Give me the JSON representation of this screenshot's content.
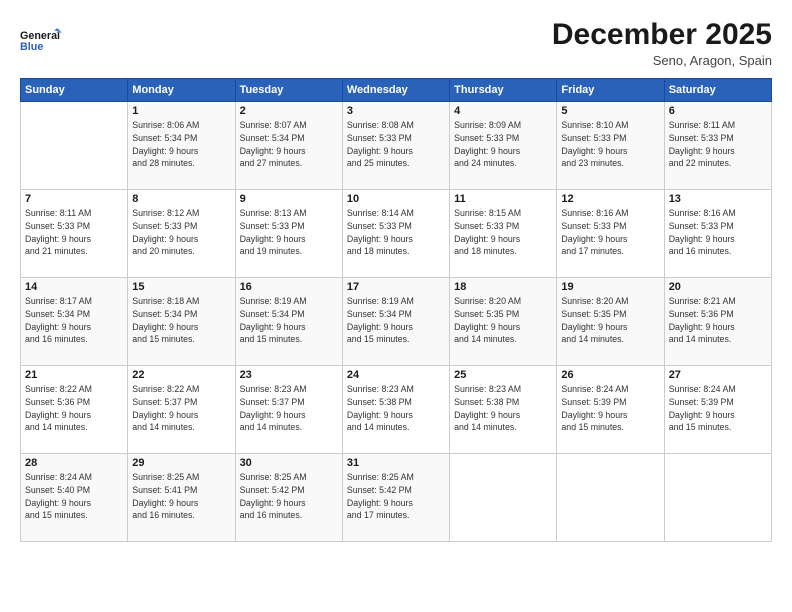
{
  "logo": {
    "line1": "General",
    "line2": "Blue"
  },
  "header": {
    "title": "December 2025",
    "subtitle": "Seno, Aragon, Spain"
  },
  "days_of_week": [
    "Sunday",
    "Monday",
    "Tuesday",
    "Wednesday",
    "Thursday",
    "Friday",
    "Saturday"
  ],
  "weeks": [
    [
      {
        "day": "",
        "detail": ""
      },
      {
        "day": "1",
        "detail": "Sunrise: 8:06 AM\nSunset: 5:34 PM\nDaylight: 9 hours\nand 28 minutes."
      },
      {
        "day": "2",
        "detail": "Sunrise: 8:07 AM\nSunset: 5:34 PM\nDaylight: 9 hours\nand 27 minutes."
      },
      {
        "day": "3",
        "detail": "Sunrise: 8:08 AM\nSunset: 5:33 PM\nDaylight: 9 hours\nand 25 minutes."
      },
      {
        "day": "4",
        "detail": "Sunrise: 8:09 AM\nSunset: 5:33 PM\nDaylight: 9 hours\nand 24 minutes."
      },
      {
        "day": "5",
        "detail": "Sunrise: 8:10 AM\nSunset: 5:33 PM\nDaylight: 9 hours\nand 23 minutes."
      },
      {
        "day": "6",
        "detail": "Sunrise: 8:11 AM\nSunset: 5:33 PM\nDaylight: 9 hours\nand 22 minutes."
      }
    ],
    [
      {
        "day": "7",
        "detail": "Sunrise: 8:11 AM\nSunset: 5:33 PM\nDaylight: 9 hours\nand 21 minutes."
      },
      {
        "day": "8",
        "detail": "Sunrise: 8:12 AM\nSunset: 5:33 PM\nDaylight: 9 hours\nand 20 minutes."
      },
      {
        "day": "9",
        "detail": "Sunrise: 8:13 AM\nSunset: 5:33 PM\nDaylight: 9 hours\nand 19 minutes."
      },
      {
        "day": "10",
        "detail": "Sunrise: 8:14 AM\nSunset: 5:33 PM\nDaylight: 9 hours\nand 18 minutes."
      },
      {
        "day": "11",
        "detail": "Sunrise: 8:15 AM\nSunset: 5:33 PM\nDaylight: 9 hours\nand 18 minutes."
      },
      {
        "day": "12",
        "detail": "Sunrise: 8:16 AM\nSunset: 5:33 PM\nDaylight: 9 hours\nand 17 minutes."
      },
      {
        "day": "13",
        "detail": "Sunrise: 8:16 AM\nSunset: 5:33 PM\nDaylight: 9 hours\nand 16 minutes."
      }
    ],
    [
      {
        "day": "14",
        "detail": "Sunrise: 8:17 AM\nSunset: 5:34 PM\nDaylight: 9 hours\nand 16 minutes."
      },
      {
        "day": "15",
        "detail": "Sunrise: 8:18 AM\nSunset: 5:34 PM\nDaylight: 9 hours\nand 15 minutes."
      },
      {
        "day": "16",
        "detail": "Sunrise: 8:19 AM\nSunset: 5:34 PM\nDaylight: 9 hours\nand 15 minutes."
      },
      {
        "day": "17",
        "detail": "Sunrise: 8:19 AM\nSunset: 5:34 PM\nDaylight: 9 hours\nand 15 minutes."
      },
      {
        "day": "18",
        "detail": "Sunrise: 8:20 AM\nSunset: 5:35 PM\nDaylight: 9 hours\nand 14 minutes."
      },
      {
        "day": "19",
        "detail": "Sunrise: 8:20 AM\nSunset: 5:35 PM\nDaylight: 9 hours\nand 14 minutes."
      },
      {
        "day": "20",
        "detail": "Sunrise: 8:21 AM\nSunset: 5:36 PM\nDaylight: 9 hours\nand 14 minutes."
      }
    ],
    [
      {
        "day": "21",
        "detail": "Sunrise: 8:22 AM\nSunset: 5:36 PM\nDaylight: 9 hours\nand 14 minutes."
      },
      {
        "day": "22",
        "detail": "Sunrise: 8:22 AM\nSunset: 5:37 PM\nDaylight: 9 hours\nand 14 minutes."
      },
      {
        "day": "23",
        "detail": "Sunrise: 8:23 AM\nSunset: 5:37 PM\nDaylight: 9 hours\nand 14 minutes."
      },
      {
        "day": "24",
        "detail": "Sunrise: 8:23 AM\nSunset: 5:38 PM\nDaylight: 9 hours\nand 14 minutes."
      },
      {
        "day": "25",
        "detail": "Sunrise: 8:23 AM\nSunset: 5:38 PM\nDaylight: 9 hours\nand 14 minutes."
      },
      {
        "day": "26",
        "detail": "Sunrise: 8:24 AM\nSunset: 5:39 PM\nDaylight: 9 hours\nand 15 minutes."
      },
      {
        "day": "27",
        "detail": "Sunrise: 8:24 AM\nSunset: 5:39 PM\nDaylight: 9 hours\nand 15 minutes."
      }
    ],
    [
      {
        "day": "28",
        "detail": "Sunrise: 8:24 AM\nSunset: 5:40 PM\nDaylight: 9 hours\nand 15 minutes."
      },
      {
        "day": "29",
        "detail": "Sunrise: 8:25 AM\nSunset: 5:41 PM\nDaylight: 9 hours\nand 16 minutes."
      },
      {
        "day": "30",
        "detail": "Sunrise: 8:25 AM\nSunset: 5:42 PM\nDaylight: 9 hours\nand 16 minutes."
      },
      {
        "day": "31",
        "detail": "Sunrise: 8:25 AM\nSunset: 5:42 PM\nDaylight: 9 hours\nand 17 minutes."
      },
      {
        "day": "",
        "detail": ""
      },
      {
        "day": "",
        "detail": ""
      },
      {
        "day": "",
        "detail": ""
      }
    ]
  ]
}
